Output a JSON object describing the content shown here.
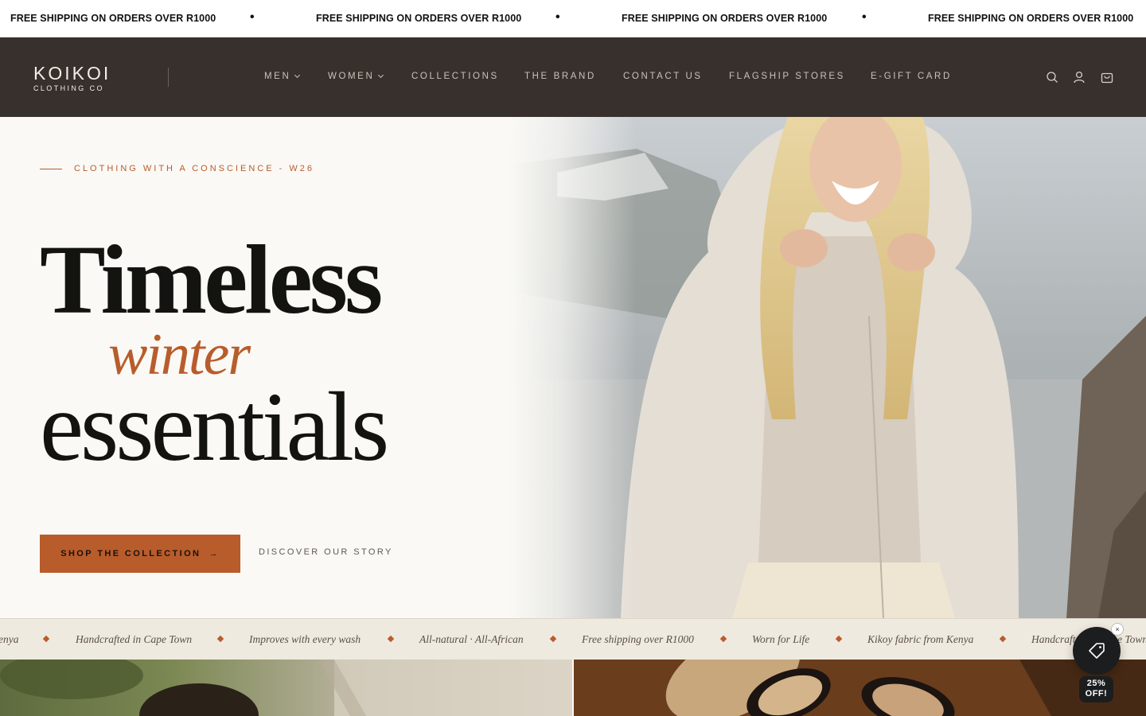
{
  "announcement": {
    "messages": [
      "FREE SHIPPING ON ORDERS OVER R1000",
      "FREE SHIPPING ON ORDERS OVER R1000",
      "FREE SHIPPING ON ORDERS OVER R1000",
      "FREE SHIPPING ON ORDERS OVER R1000"
    ],
    "separator": "•"
  },
  "header": {
    "logo_main": "KOIKOI",
    "logo_sub": "CLOTHING CO",
    "nav": [
      {
        "label": "MEN",
        "has_dropdown": true
      },
      {
        "label": "WOMEN",
        "has_dropdown": true
      },
      {
        "label": "COLLECTIONS",
        "has_dropdown": false
      },
      {
        "label": "THE BRAND",
        "has_dropdown": false
      },
      {
        "label": "CONTACT US",
        "has_dropdown": false
      },
      {
        "label": "FLAGSHIP STORES",
        "has_dropdown": false
      },
      {
        "label": "E-GIFT CARD",
        "has_dropdown": false
      }
    ],
    "icons": [
      "search-icon",
      "account-icon",
      "cart-icon"
    ],
    "colors": {
      "background": "#38302c",
      "text": "#c9c1b9"
    }
  },
  "hero": {
    "eyebrow": "CLOTHING WITH A CONSCIENCE - W26",
    "headline_line1": "Timeless",
    "headline_line2": "winter",
    "headline_line3": "essentials",
    "cta_label": "SHOP THE COLLECTION",
    "cta_arrow": "→",
    "secondary_link": "DISCOVER OUR STORY",
    "colors": {
      "accent": "#b85c2c",
      "background": "#faf9f5"
    }
  },
  "marquee": {
    "items": [
      "enya",
      "Handcrafted in Cape Town",
      "Improves with every wash",
      "All-natural · All-African",
      "Free shipping over R1000",
      "Worn for Life",
      "Kikoy fabric from Kenya",
      "Handcrafted in Cape Town"
    ]
  },
  "promo": {
    "label_line1": "25%",
    "label_line2": "OFF!",
    "close": "×"
  }
}
